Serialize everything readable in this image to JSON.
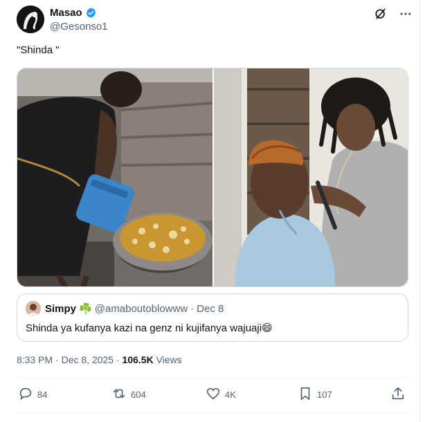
{
  "author": {
    "name": "Masao",
    "handle": "@Gesonso1"
  },
  "tweet": {
    "text": "\"Shinda \""
  },
  "quote": {
    "name": "Simpy",
    "name_emoji": "☘️",
    "handle": "@amaboutoblowww",
    "separator": "·",
    "date": "Dec 8",
    "text": "Shinda ya kufanya kazi na genz ni kujifanya wajuaji",
    "text_emoji": "😄"
  },
  "meta": {
    "time": "8:33 PM",
    "separator": "·",
    "date": "Dec 8, 2025",
    "separator2": "·",
    "views_count": "106.5K",
    "views_label": "Views"
  },
  "actions": {
    "replies": "84",
    "retweets": "604",
    "likes": "4K",
    "bookmarks": "107"
  },
  "icons": {
    "verified": "verified-badge-icon",
    "grok": "grok-icon",
    "more": "more-icon",
    "reply": "reply-icon",
    "retweet": "retweet-icon",
    "like": "heart-icon",
    "bookmark": "bookmark-icon",
    "share": "share-icon"
  },
  "colors": {
    "accent": "#1d9bf0",
    "text": "#0f1419",
    "muted": "#536471",
    "border": "#cfd9de"
  }
}
